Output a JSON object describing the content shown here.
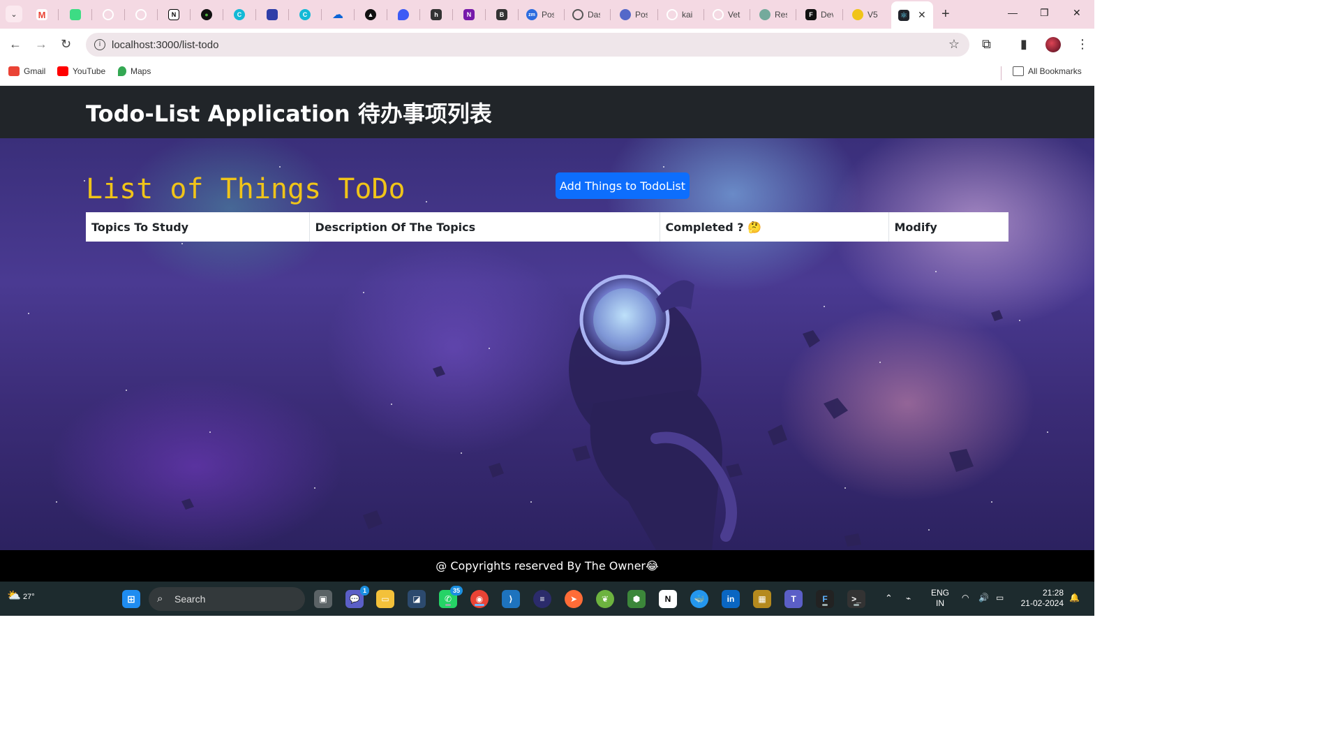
{
  "browser": {
    "tabs": [
      {
        "label": "",
        "icon": "gmail"
      },
      {
        "label": "",
        "icon": "android"
      },
      {
        "label": "",
        "icon": "github"
      },
      {
        "label": "",
        "icon": "github"
      },
      {
        "label": "",
        "icon": "notion"
      },
      {
        "label": "",
        "icon": "mongodb"
      },
      {
        "label": "",
        "icon": "canva"
      },
      {
        "label": "",
        "icon": "app"
      },
      {
        "label": "",
        "icon": "canva"
      },
      {
        "label": "",
        "icon": "onedrive"
      },
      {
        "label": "",
        "icon": "arc"
      },
      {
        "label": "",
        "icon": "app"
      },
      {
        "label": "",
        "icon": "hashnode"
      },
      {
        "label": "",
        "icon": "onenote"
      },
      {
        "label": "",
        "icon": "bootstrap"
      },
      {
        "label": "Pos",
        "icon": "zoom"
      },
      {
        "label": "Das",
        "icon": "google"
      },
      {
        "label": "Pos",
        "icon": "app"
      },
      {
        "label": "kai",
        "icon": "github"
      },
      {
        "label": "Vet",
        "icon": "github"
      },
      {
        "label": "Res",
        "icon": "chatgpt"
      },
      {
        "label": "Dev",
        "icon": "framer"
      },
      {
        "label": "V5",
        "icon": "app"
      },
      {
        "label": "",
        "icon": "react",
        "active": true
      }
    ],
    "url": "localhost:3000/list-todo",
    "bookmarks": [
      {
        "label": "Gmail",
        "color": "#ea4335"
      },
      {
        "label": "YouTube",
        "color": "#ff0000"
      },
      {
        "label": "Maps",
        "color": "#34a853"
      }
    ],
    "all_bookmarks": "All Bookmarks"
  },
  "app": {
    "title": "Todo-List Application 待办事项列表",
    "heading": "List of Things ToDo",
    "add_button": "Add Things to TodoList",
    "table": {
      "columns": [
        "Topics To Study",
        "Description Of The Topics",
        "Completed ? 🤔",
        "Modify"
      ],
      "rows": []
    },
    "footer": "@ Copyrights reserved By The Owner😂"
  },
  "taskbar": {
    "weather_temp": "27°",
    "search_label": "Search",
    "teams_badge": "1",
    "whatsapp_badge": "35",
    "language": [
      "ENG",
      "IN"
    ],
    "time": "21:28",
    "date": "21-02-2024"
  },
  "colors": {
    "header_bg": "#212529",
    "heading_color": "#f0c419",
    "button_bg": "#0d6efd",
    "footer_bg": "#000000",
    "tabstrip_bg": "#f4d9e3"
  }
}
